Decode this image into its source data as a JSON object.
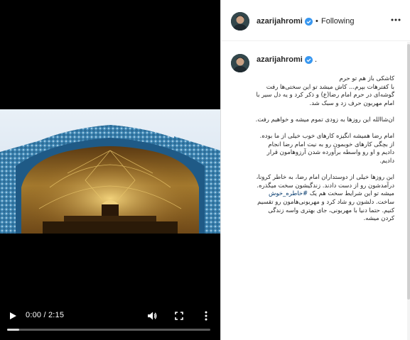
{
  "video": {
    "time_display": "0:00 / 2:15",
    "progress_fraction": 0.06
  },
  "post": {
    "username": "azarijahromi",
    "separator": "•",
    "follow_status": "Following",
    "caption_username": "azarijahromi",
    "caption_after_name": ".",
    "caption_paragraphs": [
      "کاشکی باز هم تو حرم\nبا کفترهات بپرم... کاش میشد تو این سختی‌ها رفت گوشه‌ای در حرم امام رضا(ع) و ذکر کرد و یه دل سیر با امام مهربون حرف زد و سبک شد.",
      "ان‌شاالله این روزها به زودی تموم میشه و خواهیم رفت.",
      "امام رضا همیشه انگیزه کارهای خوب خیلی از ما بوده. از بچگی کارهای خوبمون رو به نیت امام رضا انجام دادیم و او رو واسطه برآورده شدن آرزوهامون قرار دادیم.",
      "این روزها خیلی از دوستداران امام رضا، به خاطر کرونا، درآمدشون رو از دست دادند. زندگیشون سخت میگذره. میشه تو این شرایط سخت هم یک",
      "ساخت. دلشون رو شاد کرد و مهربونی‌هامون رو تقسیم کنیم. حتما دنیا با مهربونی، جای بهتری واسه زندگی کردن میشه."
    ],
    "hashtag": "#خاطره_خوش"
  },
  "icons": {
    "play": "play-icon",
    "volume": "volume-icon",
    "fullscreen": "fullscreen-icon",
    "more_vertical": "more-vertical-icon",
    "more_horizontal": "more-horizontal-icon",
    "verified": "verified-badge-icon"
  },
  "colors": {
    "verified_blue": "#3897f0",
    "hashtag": "#00376b",
    "text": "#262626"
  }
}
